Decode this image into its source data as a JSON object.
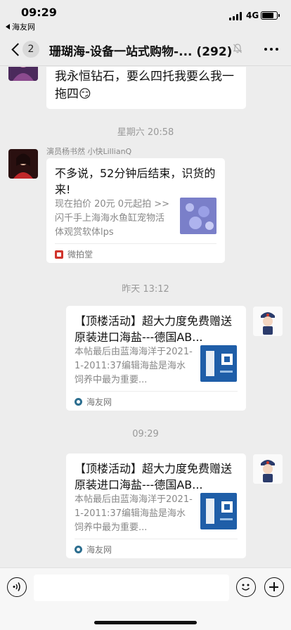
{
  "status_bar": {
    "time": "09:29",
    "back_app": "海友网",
    "network": "4G"
  },
  "nav": {
    "unread_count": "2",
    "title": "珊瑚海-设备一站式购物-...",
    "member_count": "(292)"
  },
  "messages": {
    "msg1": {
      "text": "我永恒钻石，要么四托我要么我一拖四",
      "emoji": "😏"
    },
    "ts1": "星期六 20:58",
    "msg2": {
      "sender": "演员杨书然 小快LillianQ",
      "text": "不多说，52分钟后结束，识货的来!",
      "desc": "现在拍价 20元 0元起拍 >> 闪千手上海海水鱼缸宠物活体观赏软体lps",
      "source": "微拍堂"
    },
    "ts2": "昨天 13:12",
    "card1": {
      "title": "【顶楼活动】超大力度免费赠送原装进口海盐---德国AB...",
      "desc": "本帖最后由蓝海海洋于2021-1-2011:37编辑海盐是海水饲养中最为重要...",
      "source": "海友网"
    },
    "ts3": "09:29",
    "card2": {
      "title": "【顶楼活动】超大力度免费赠送原装进口海盐---德国AB...",
      "desc": "本帖最后由蓝海海洋于2021-1-2011:37编辑海盐是海水饲养中最为重要...",
      "source": "海友网"
    }
  },
  "colors": {
    "background": "#ededed",
    "bubble": "#ffffff",
    "timestamp": "#999999"
  }
}
